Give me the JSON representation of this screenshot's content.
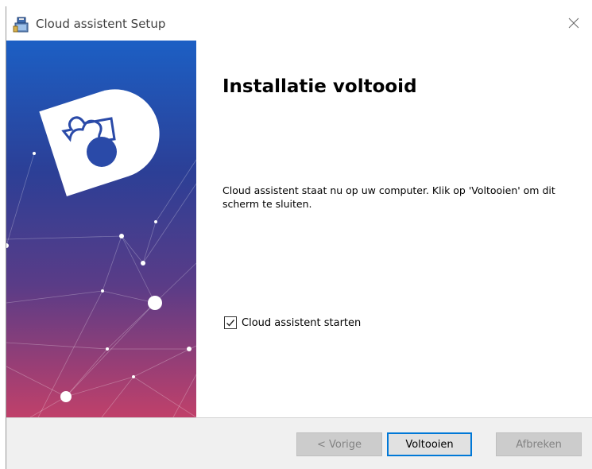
{
  "window": {
    "title": "Cloud assistent Setup"
  },
  "main": {
    "heading": "Installatie voltooid",
    "body": "Cloud assistent staat nu op uw computer. Klik op 'Voltooien' om dit scherm te sluiten.",
    "checkbox": {
      "label": "Cloud assistent starten",
      "checked": true
    }
  },
  "footer": {
    "back_label": "< Vorige",
    "finish_label": "Voltooien",
    "cancel_label": "Afbreken"
  },
  "colors": {
    "banner_top": "#1c5fc4",
    "banner_bottom": "#c0406a",
    "focus_border": "#0078d7"
  },
  "icons": {
    "app": "installer-icon",
    "close": "close-icon",
    "logo": "puzzle-logo-icon"
  }
}
